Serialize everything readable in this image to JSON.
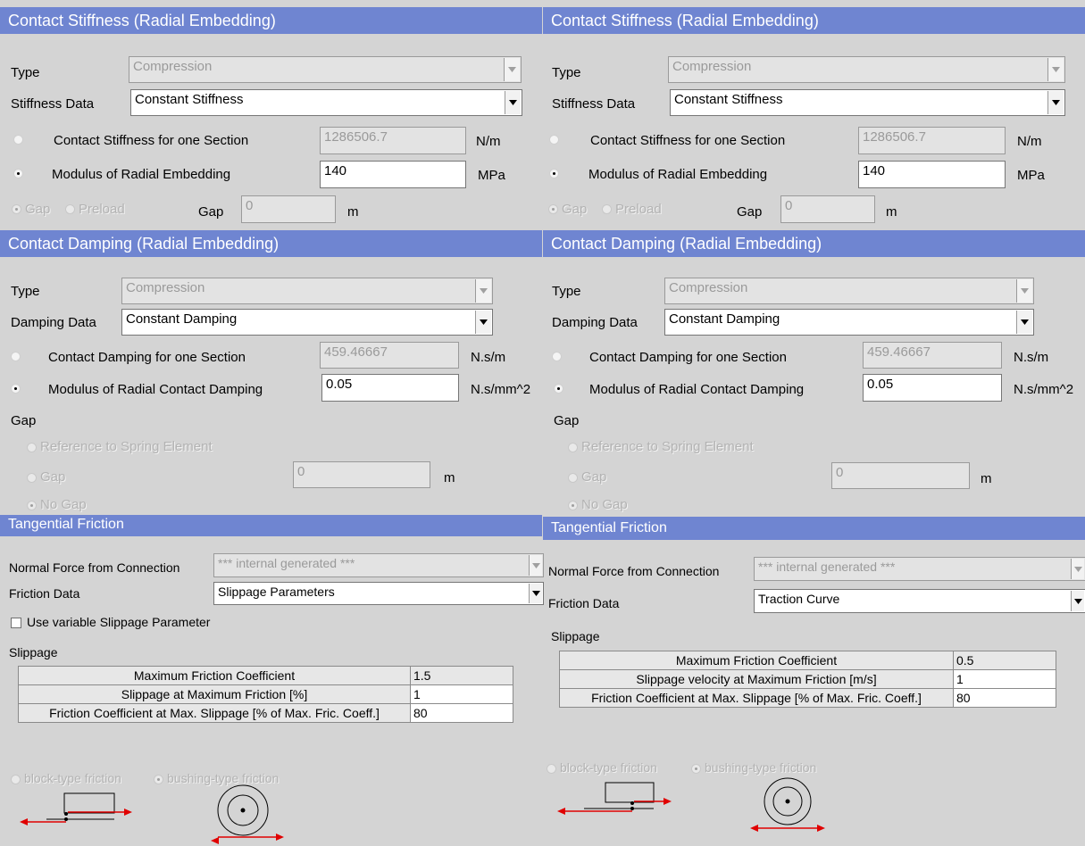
{
  "left": {
    "stiffness": {
      "title": "Contact Stiffness (Radial Embedding)",
      "type_label": "Type",
      "type_value": "Compression",
      "data_label": "Stiffness Data",
      "data_value": "Constant Stiffness",
      "section_label": "Contact Stiffness for one Section",
      "section_value": "1286506.7",
      "section_unit": "N/m",
      "modulus_label": "Modulus of Radial Embedding",
      "modulus_value": "140",
      "modulus_unit": "MPa",
      "gap_option": "Gap",
      "preload_option": "Preload",
      "gap_label": "Gap",
      "gap_value": "0",
      "gap_unit": "m"
    },
    "damping": {
      "title": "Contact Damping (Radial Embedding)",
      "type_label": "Type",
      "type_value": "Compression",
      "data_label": "Damping Data",
      "data_value": "Constant Damping",
      "section_label": "Contact Damping for one Section",
      "section_value": "459.46667",
      "section_unit": "N.s/m",
      "modulus_label": "Modulus of Radial Contact Damping",
      "modulus_value": "0.05",
      "modulus_unit": "N.s/mm^2",
      "gap_heading": "Gap",
      "ref_option": "Reference to Spring Element",
      "gap_option": "Gap",
      "gap_value": "0",
      "gap_unit": "m",
      "nogap_option": "No Gap"
    },
    "friction": {
      "title": "Tangential Friction",
      "normal_label": "Normal Force from Connection",
      "normal_value": "*** internal generated ***",
      "data_label": "Friction Data",
      "data_value": "Slippage Parameters",
      "variable_label": "Use variable Slippage Parameter",
      "slippage_heading": "Slippage",
      "rows": [
        {
          "label": "Maximum Friction Coefficient",
          "value": "1.5"
        },
        {
          "label": "Slippage at Maximum Friction [%]",
          "value": "1"
        },
        {
          "label": "Friction Coefficient at Max. Slippage [% of Max. Fric. Coeff.]",
          "value": "80"
        }
      ],
      "block_option": "block-type friction",
      "bushing_option": "bushing-type friction"
    }
  },
  "right": {
    "stiffness": {
      "title": "Contact Stiffness (Radial Embedding)",
      "type_label": "Type",
      "type_value": "Compression",
      "data_label": "Stiffness Data",
      "data_value": "Constant Stiffness",
      "section_label": "Contact Stiffness for one Section",
      "section_value": "1286506.7",
      "section_unit": "N/m",
      "modulus_label": "Modulus of Radial Embedding",
      "modulus_value": "140",
      "modulus_unit": "MPa",
      "gap_option": "Gap",
      "preload_option": "Preload",
      "gap_label": "Gap",
      "gap_value": "0",
      "gap_unit": "m"
    },
    "damping": {
      "title": "Contact Damping (Radial Embedding)",
      "type_label": "Type",
      "type_value": "Compression",
      "data_label": "Damping Data",
      "data_value": "Constant Damping",
      "section_label": "Contact Damping for one Section",
      "section_value": "459.46667",
      "section_unit": "N.s/m",
      "modulus_label": "Modulus of Radial Contact Damping",
      "modulus_value": "0.05",
      "modulus_unit": "N.s/mm^2",
      "gap_heading": "Gap",
      "ref_option": "Reference to Spring Element",
      "gap_option": "Gap",
      "gap_value": "0",
      "gap_unit": "m",
      "nogap_option": "No Gap"
    },
    "friction": {
      "title": "Tangential Friction",
      "normal_label": "Normal Force from Connection",
      "normal_value": "*** internal generated ***",
      "data_label": "Friction Data",
      "data_value": "Traction Curve",
      "slippage_heading": "Slippage",
      "rows": [
        {
          "label": "Maximum Friction Coefficient",
          "value": "0.5"
        },
        {
          "label": "Slippage velocity at Maximum Friction [m/s]",
          "value": "1"
        },
        {
          "label": "Friction Coefficient at Max. Slippage [% of Max. Fric. Coeff.]",
          "value": "80"
        }
      ],
      "block_option": "block-type friction",
      "bushing_option": "bushing-type friction"
    }
  },
  "colors": {
    "section_header": "#6f85d1",
    "panel_background": "#d4d4d4",
    "force_arrow": "#e00000"
  }
}
